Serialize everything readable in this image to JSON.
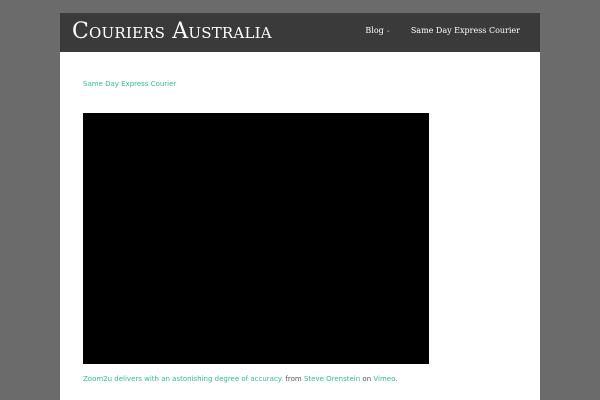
{
  "header": {
    "site_title": "Couriers Australia",
    "nav": {
      "blog_label": "Blog",
      "same_day_label": "Same Day Express Courier"
    }
  },
  "content": {
    "page_link": "Same Day Express Courier",
    "caption": {
      "video_link": "Zoom2u delivers with an astonishing degree of accuracy.",
      "from_text": "from",
      "author_link": "Steve Orenstein",
      "on_text": "on",
      "platform_link": "Vimeo",
      "period": "."
    }
  },
  "colors": {
    "background": "#6b6b6b",
    "header": "#3a3a3a",
    "link": "#2fbf8a",
    "video": "#000000"
  }
}
